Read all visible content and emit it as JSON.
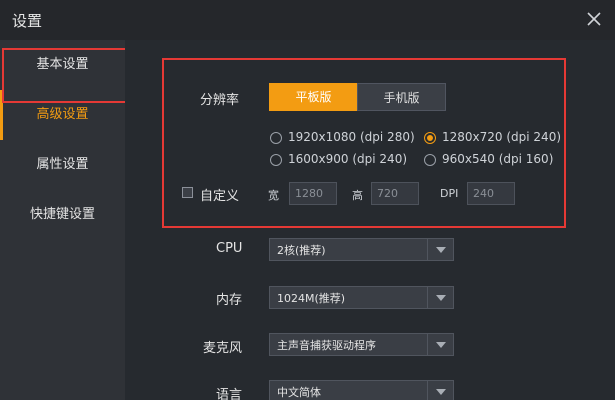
{
  "window": {
    "title": "设置"
  },
  "sidebar": {
    "items": [
      {
        "label": "基本设置"
      },
      {
        "label": "高级设置"
      },
      {
        "label": "属性设置"
      },
      {
        "label": "快捷键设置"
      }
    ],
    "active_index": 1
  },
  "resolution": {
    "label": "分辨率",
    "modes": [
      {
        "label": "平板版",
        "selected": true
      },
      {
        "label": "手机版",
        "selected": false
      }
    ],
    "options": [
      {
        "label": "1920x1080 (dpi 280)",
        "checked": false
      },
      {
        "label": "1280x720 (dpi 240)",
        "checked": true
      },
      {
        "label": "1600x900 (dpi 240)",
        "checked": false
      },
      {
        "label": "960x540 (dpi 160)",
        "checked": false
      }
    ],
    "custom": {
      "label": "自定义",
      "checked": false,
      "width_label": "宽",
      "width_value": "1280",
      "height_label": "高",
      "height_value": "720",
      "dpi_label": "DPI",
      "dpi_value": "240"
    }
  },
  "settings": [
    {
      "label": "CPU",
      "value": "2核(推荐)"
    },
    {
      "label": "内存",
      "value": "1024M(推荐)"
    },
    {
      "label": "麦克风",
      "value": "主声音捕获驱动程序"
    },
    {
      "label": "语言",
      "value": "中文简体"
    }
  ],
  "colors": {
    "accent": "#f39c12",
    "highlight_box": "#e53935",
    "background": "#2f3237"
  }
}
